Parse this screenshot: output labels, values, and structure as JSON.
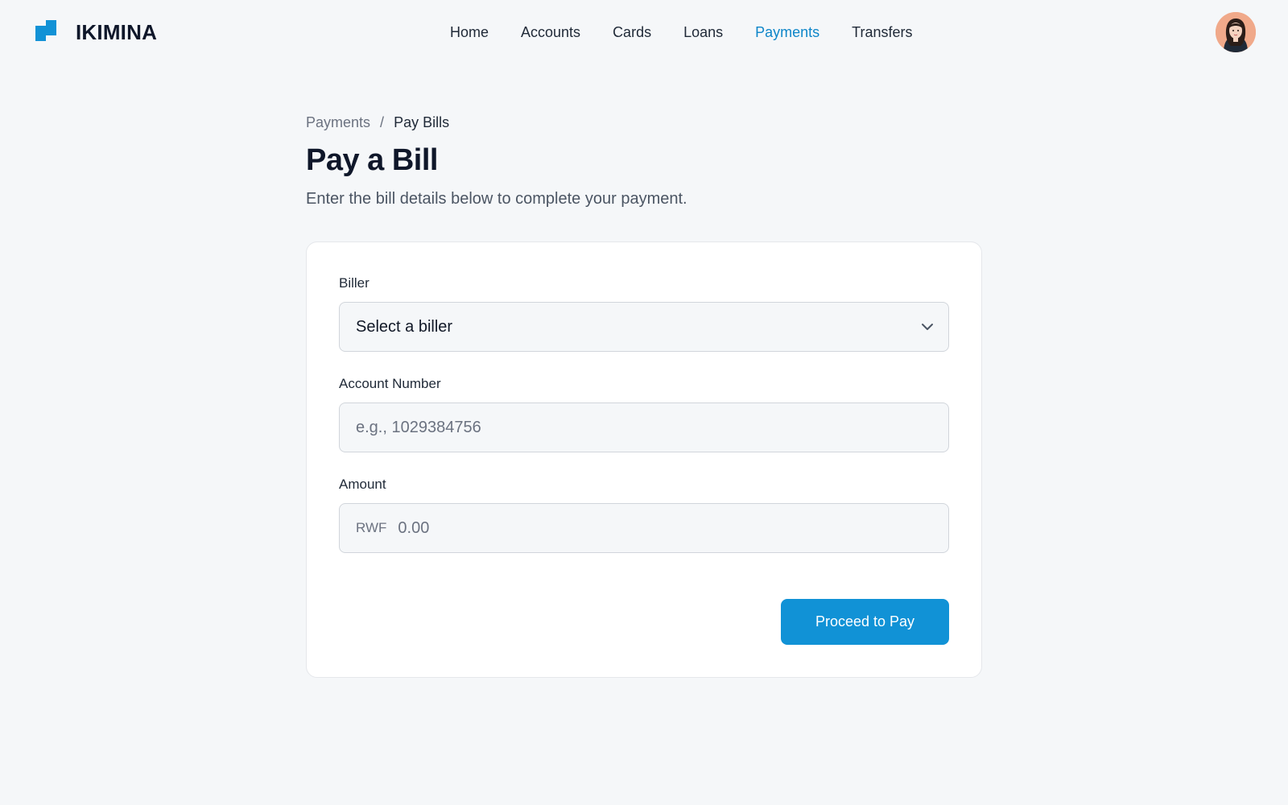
{
  "app": {
    "brand_name": "IKIMINA",
    "accent_color": "#1192d6"
  },
  "nav": {
    "items": [
      {
        "label": "Home",
        "active": false
      },
      {
        "label": "Accounts",
        "active": false
      },
      {
        "label": "Cards",
        "active": false
      },
      {
        "label": "Loans",
        "active": false
      },
      {
        "label": "Payments",
        "active": true
      },
      {
        "label": "Transfers",
        "active": false
      }
    ]
  },
  "user": {
    "avatar_icon": "user-avatar"
  },
  "breadcrumb": {
    "parent": "Payments",
    "separator": "/",
    "current": "Pay Bills"
  },
  "page": {
    "title": "Pay a Bill",
    "subtitle": "Enter the bill details below to complete your payment."
  },
  "form": {
    "biller": {
      "label": "Biller",
      "selected": "Select a biller"
    },
    "account_number": {
      "label": "Account Number",
      "placeholder": "e.g., 1029384756"
    },
    "amount": {
      "label": "Amount",
      "currency": "RWF",
      "placeholder": "0.00"
    },
    "submit_label": "Proceed to Pay"
  }
}
